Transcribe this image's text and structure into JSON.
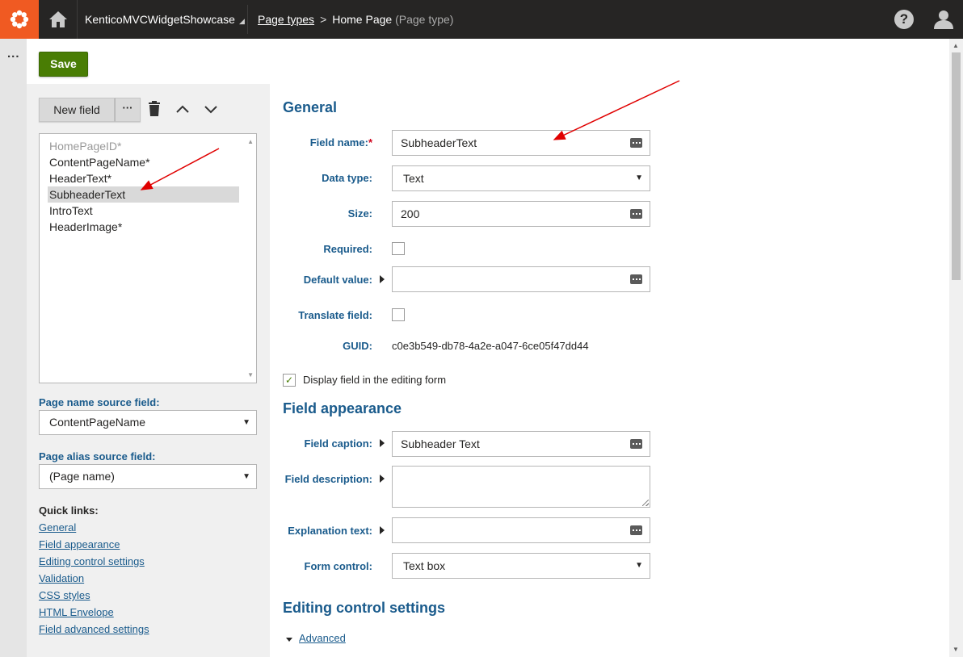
{
  "header": {
    "site_name": "KenticoMVCWidgetShowcase",
    "site_caret": "◢",
    "breadcrumb_link": "Page types",
    "breadcrumb_separator": ">",
    "breadcrumb_current": "Home Page",
    "breadcrumb_suffix": "(Page type)",
    "help_label": "?"
  },
  "strip": {
    "more_label": "..."
  },
  "toolbar": {
    "save_label": "Save"
  },
  "fields_panel": {
    "new_field_label": "New field",
    "more_label": "···",
    "fields": [
      {
        "label": "HomePageID*",
        "state": "disabled"
      },
      {
        "label": "ContentPageName*",
        "state": "normal"
      },
      {
        "label": "HeaderText*",
        "state": "normal"
      },
      {
        "label": "SubheaderText",
        "state": "selected"
      },
      {
        "label": "IntroText",
        "state": "normal"
      },
      {
        "label": "HeaderImage*",
        "state": "normal"
      }
    ],
    "page_name_source_label": "Page name source field:",
    "page_name_source_value": "ContentPageName",
    "page_alias_source_label": "Page alias source field:",
    "page_alias_source_value": "(Page name)",
    "quick_links_title": "Quick links:",
    "quick_links": [
      "General",
      "Field appearance",
      "Editing control settings",
      "Validation",
      "CSS styles",
      "HTML Envelope",
      "Field advanced settings"
    ]
  },
  "general": {
    "title": "General",
    "field_name_label": "Field name:",
    "field_name_required": "*",
    "field_name_value": "SubheaderText",
    "data_type_label": "Data type:",
    "data_type_value": "Text",
    "size_label": "Size:",
    "size_value": "200",
    "required_label": "Required:",
    "default_value_label": "Default value:",
    "default_value_value": "",
    "translate_label": "Translate field:",
    "guid_label": "GUID:",
    "guid_value": "c0e3b549-db78-4a2e-a047-6ce05f47dd44",
    "display_field_label": "Display field in the editing form",
    "display_field_checked": "✓"
  },
  "appearance": {
    "title": "Field appearance",
    "caption_label": "Field caption:",
    "caption_value": "Subheader Text",
    "description_label": "Field description:",
    "explanation_label": "Explanation text:",
    "form_control_label": "Form control:",
    "form_control_value": "Text box"
  },
  "editing_control": {
    "title": "Editing control settings",
    "advanced_label": "Advanced"
  },
  "colors": {
    "accent": "#1a5b8c",
    "save": "#497d04",
    "logo": "#f05a22",
    "topbar": "#262524",
    "annotation": "#e00000"
  }
}
